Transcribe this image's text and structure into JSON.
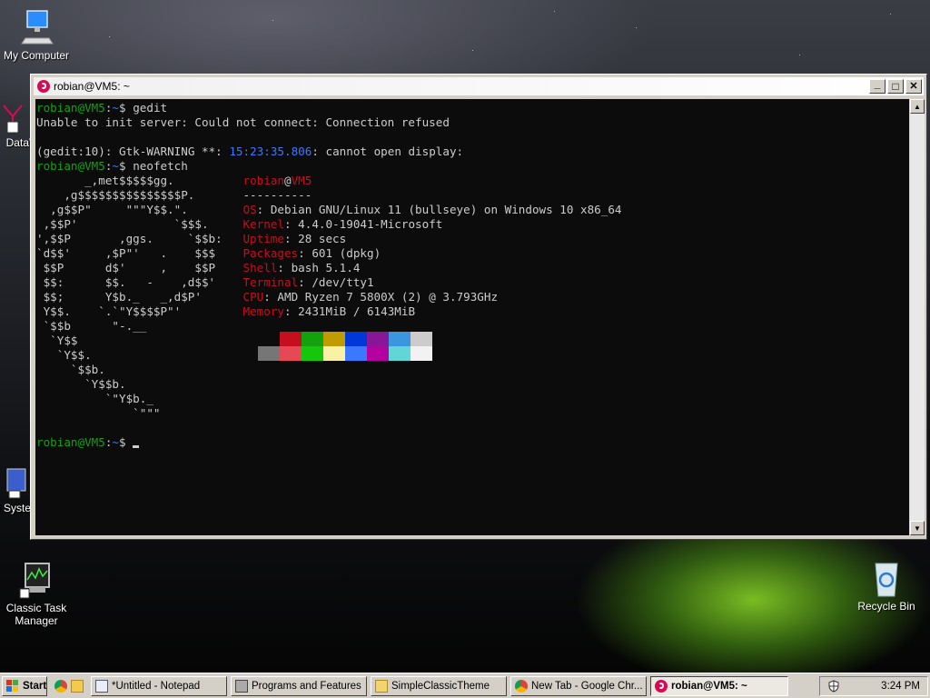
{
  "desktop": {
    "icons": [
      {
        "label": "My Computer"
      },
      {
        "label": "DataV"
      },
      {
        "label": "Cl Syste"
      },
      {
        "label": "Classic Task Manager"
      },
      {
        "label": "Recycle Bin"
      }
    ]
  },
  "window": {
    "title": "robian@VM5: ~",
    "buttons": {
      "minimize": "_",
      "maximize": "□",
      "close": "✕"
    }
  },
  "terminal": {
    "prompt_user": "robian@VM5",
    "prompt_sep": ":",
    "prompt_dir": "~",
    "prompt_sign": "$",
    "cmd1": " gedit",
    "out1": "Unable to init server: Could not connect: Connection refused",
    "warn_prefix": "(gedit:10): Gtk-",
    "warn_word": "WARNING",
    "warn_mid": " **: ",
    "warn_time": "15:23:35.806",
    "warn_suffix": ": cannot open display:",
    "cmd2": " neofetch",
    "ascii": [
      "       _,met$$$$$gg.",
      "    ,g$$$$$$$$$$$$$$$P.",
      "  ,g$$P\"     \"\"\"Y$$.\".",
      " ,$$P'              `$$$.",
      "',$$P       ,ggs.     `$$b:",
      "`d$$'     ,$P\"'   .    $$$",
      " $$P      d$'     ,    $$P",
      " $$:      $$.   -    ,d$$'",
      " $$;      Y$b._   _,d$P'",
      " Y$$.    `.`\"Y$$$$P\"'",
      " `$$b      \"-.__",
      "  `Y$$",
      "   `Y$$.",
      "     `$$b.",
      "       `Y$$b.",
      "          `\"Y$b._",
      "              `\"\"\""
    ],
    "info_user": "robian",
    "info_at": "@",
    "info_host": "VM5",
    "info_sep": "----------",
    "info": [
      {
        "key": "OS",
        "value": "Debian GNU/Linux 11 (bullseye) on Windows 10 x86_64"
      },
      {
        "key": "Kernel",
        "value": "4.4.0-19041-Microsoft"
      },
      {
        "key": "Uptime",
        "value": "28 secs"
      },
      {
        "key": "Packages",
        "value": "601 (dpkg)"
      },
      {
        "key": "Shell",
        "value": "bash 5.1.4"
      },
      {
        "key": "Terminal",
        "value": "/dev/tty1"
      },
      {
        "key": "CPU",
        "value": "AMD Ryzen 7 5800X (2) @ 3.793GHz"
      },
      {
        "key": "Memory",
        "value": "2431MiB / 6143MiB"
      }
    ],
    "palette_top": [
      "#0c0c0c",
      "#c50f1f",
      "#13a10e",
      "#c19c00",
      "#0037da",
      "#881798",
      "#3a96dd",
      "#cccccc"
    ],
    "palette_bottom": [
      "#767676",
      "#e74856",
      "#16c60c",
      "#f9f1a5",
      "#3b78ff",
      "#b4009e",
      "#61d6d6",
      "#f2f2f2"
    ]
  },
  "taskbar": {
    "start": "Start",
    "items": [
      {
        "label": "*Untitled - Notepad"
      },
      {
        "label": "Programs and Features"
      },
      {
        "label": "SimpleClassicTheme"
      },
      {
        "label": "New Tab - Google Chr..."
      },
      {
        "label": "robian@VM5: ~"
      }
    ],
    "clock": "3:24 PM"
  }
}
